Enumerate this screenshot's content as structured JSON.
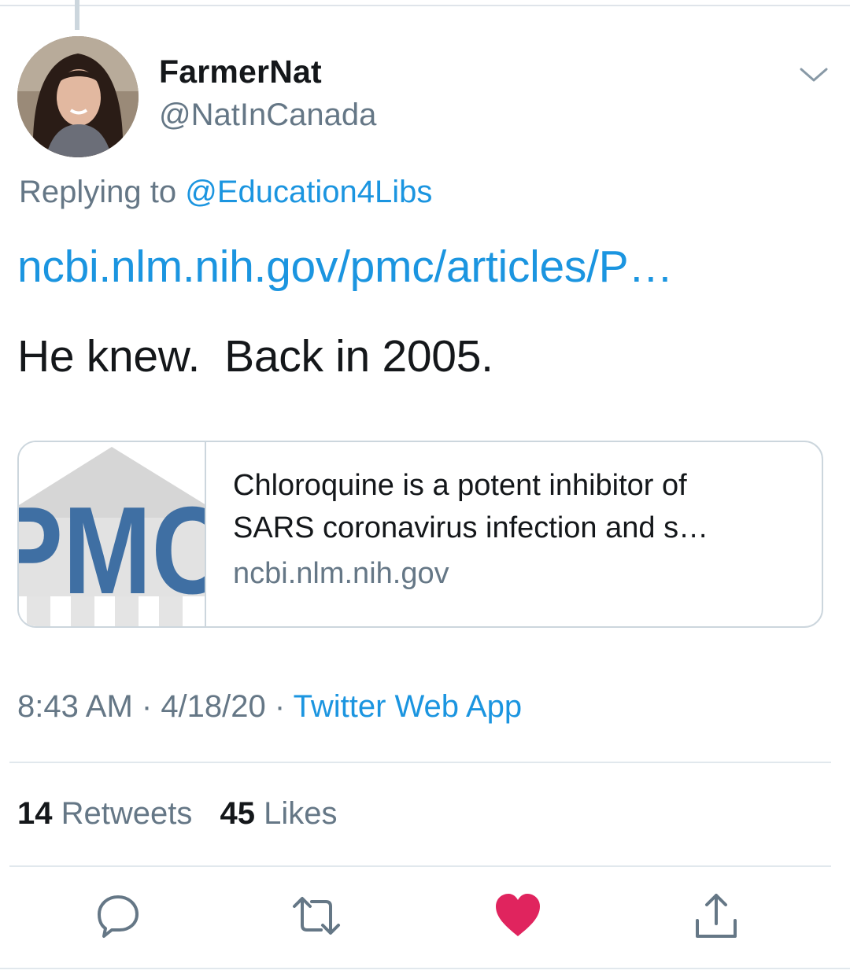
{
  "author": {
    "display_name": "FarmerNat",
    "handle": "@NatInCanada"
  },
  "reply": {
    "prefix": "Replying to ",
    "mention": "@Education4Libs"
  },
  "tweet": {
    "link_text": "ncbi.nlm.nih.gov/pmc/articles/P…",
    "text": "He knew.  Back in 2005."
  },
  "card": {
    "image_logo_text": "PMC",
    "title_line1": "Chloroquine is a potent inhibitor of",
    "title_line2": "SARS coronavirus infection and s…",
    "domain": "ncbi.nlm.nih.gov"
  },
  "meta": {
    "time": "8:43 AM",
    "separator": " · ",
    "date": "4/18/20",
    "source": "Twitter Web App"
  },
  "stats": {
    "retweet_count": "14",
    "retweet_label": "Retweets",
    "like_count": "45",
    "like_label": "Likes"
  },
  "icons": {
    "reply": "reply-icon",
    "retweet": "retweet-icon",
    "like": "heart-icon",
    "share": "share-icon",
    "menu": "chevron-down-icon"
  },
  "colors": {
    "link_blue": "#1b95e0",
    "secondary_gray": "#657786",
    "like_red": "#e0245e",
    "pmc_blue": "#3f6fa3"
  }
}
